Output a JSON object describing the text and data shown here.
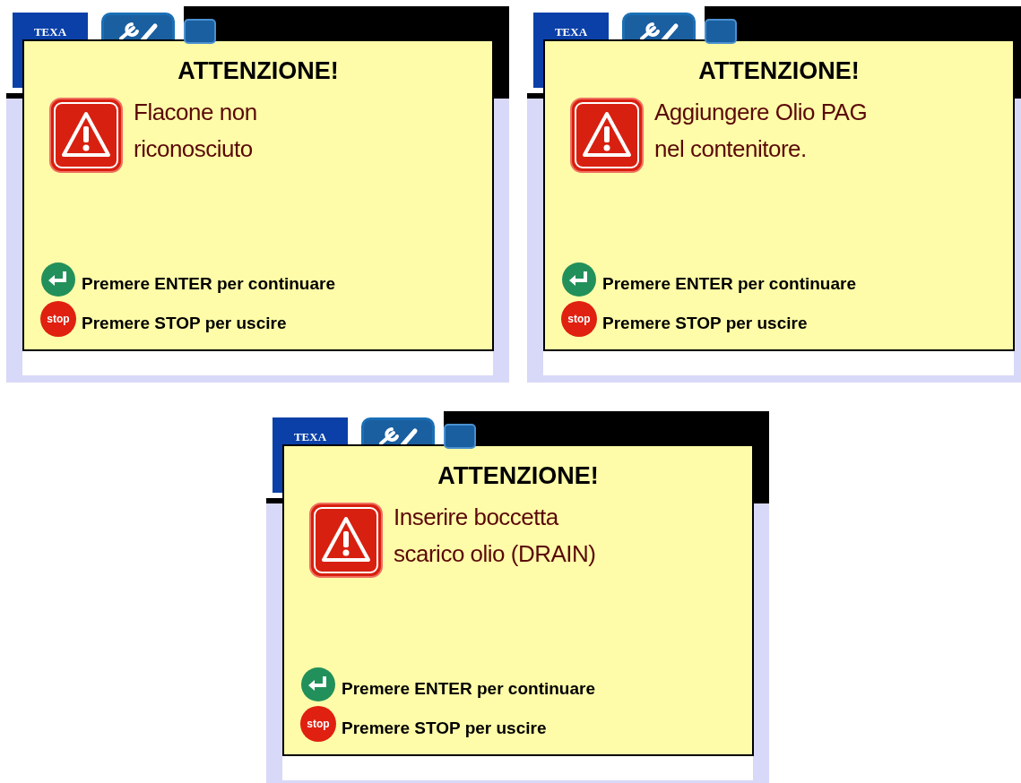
{
  "screens": [
    {
      "logo": "TEXA",
      "title": "ATTENZIONE!",
      "message": "Flacone non\nriconosciuto",
      "actions": [
        {
          "kind": "enter",
          "text": "Premere ENTER per continuare"
        },
        {
          "kind": "stop",
          "icon_text": "stop",
          "text": "Premere STOP per uscire"
        }
      ]
    },
    {
      "logo": "TEXA",
      "title": "ATTENZIONE!",
      "message": "Aggiungere Olio PAG\nnel contenitore.",
      "actions": [
        {
          "kind": "enter",
          "text": "Premere ENTER per continuare"
        },
        {
          "kind": "stop",
          "icon_text": "stop",
          "text": "Premere STOP per uscire"
        }
      ]
    },
    {
      "logo": "TEXA",
      "title": "ATTENZIONE!",
      "message": "Inserire boccetta\nscarico olio (DRAIN)",
      "actions": [
        {
          "kind": "enter",
          "text": "Premere ENTER per continuare"
        },
        {
          "kind": "stop",
          "icon_text": "stop",
          "text": "Premere STOP per uscire"
        }
      ]
    }
  ]
}
